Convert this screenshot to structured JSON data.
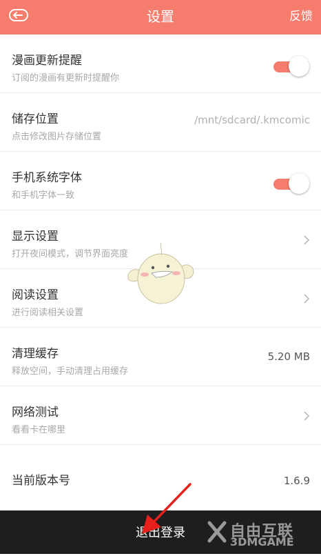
{
  "header": {
    "title": "设置",
    "feedback_label": "反馈",
    "back_icon": "back-icon",
    "background": "#f67c6e"
  },
  "settings": [
    {
      "title": "漫画更新提醒",
      "subtitle": "订阅的漫画有更新时提醒你",
      "control": "toggle",
      "enabled": true
    },
    {
      "title": "储存位置",
      "subtitle": "点击修改图片存储位置",
      "value": "/mnt/sdcard/.kmcomic"
    },
    {
      "title": "手机系统字体",
      "subtitle": "和手机字体一致",
      "control": "toggle",
      "enabled": true
    },
    {
      "title": "显示设置",
      "subtitle": "打开夜间模式，调节界面亮度",
      "control": "chevron"
    },
    {
      "title": "阅读设置",
      "subtitle": "进行阅读相关设置",
      "control": "chevron"
    },
    {
      "title": "清理缓存",
      "subtitle": "释放空间，手动清理占用缓存",
      "value": "5.20 MB"
    },
    {
      "title": "网络测试",
      "subtitle": "看看卡在哪里",
      "control": "chevron"
    },
    {
      "title": "当前版本号",
      "value": "1.6.9"
    }
  ],
  "footer": {
    "logout_label": "退出登录",
    "background": "#1e1e1e"
  },
  "watermark": {
    "line1": "自由互联",
    "line2": "3DMGAME"
  },
  "colors": {
    "accent": "#f67c6e",
    "annotation_arrow": "#e8201c"
  }
}
